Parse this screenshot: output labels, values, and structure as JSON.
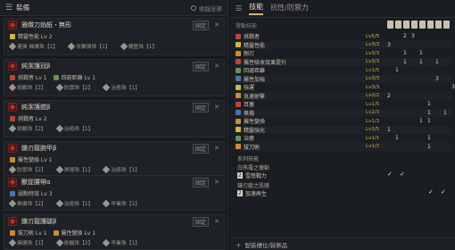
{
  "left_header": {
    "menu_icon": "hamburger-icon",
    "title": "裝備",
    "toggle_label": "收起全部"
  },
  "slots": [
    {
      "name": "雅緻刀焰紙・無形",
      "fix_label": "固定",
      "skills": [
        {
          "name": "精靈性能 Lv 2",
          "color": "y"
        }
      ],
      "decorations": [
        "連弾 擁護珠【1】",
        "攻擊弾珠【1】",
        "護壁珠【1】"
      ]
    },
    {
      "name": "純潔護冠β",
      "fix_label": "固定",
      "skills": [
        {
          "name": "挑戰者 Lv 1",
          "color": "r"
        },
        {
          "name": "回避距離 Lv 1",
          "color": "g"
        }
      ],
      "decorations": [
        "挑戰珠【2】",
        "防禦珠【2】",
        "治癒珠【1】"
      ]
    },
    {
      "name": "純潔護鎧β",
      "fix_label": "固定",
      "skills": [
        {
          "name": "挑戰者 Lv 2",
          "color": "r"
        }
      ],
      "decorations": [
        "挑戰珠【2】",
        "治癒珠【1】"
      ]
    },
    {
      "name": "鎌刃龍腕甲β",
      "fix_label": "固定",
      "skills": [
        {
          "name": "屬性變換 Lv 1",
          "color": "o"
        }
      ],
      "decorations": [
        "防禦珠【2】",
        "昂揚珠【1】",
        "治癒珠【1】"
      ]
    },
    {
      "name": "獸捉腰帶α",
      "fix_label": "固定",
      "skills": [
        {
          "name": "弱點特效 Lv 3",
          "color": "b"
        }
      ],
      "decorations": [
        "無傷珠【2】",
        "治癒珠【1】",
        "早業珠【1】"
      ]
    },
    {
      "name": "鎌刃龍護腿β",
      "fix_label": "固定",
      "skills": [
        {
          "name": "拔刀術 Lv 1",
          "color": "o"
        },
        {
          "name": "屬性變換 Lv 1",
          "color": "o"
        }
      ],
      "decorations": [
        "擁護珠【1】",
        "挑戰珠【2】",
        "早業珠【1】"
      ]
    }
  ],
  "right_header": {
    "icon": "sliders-icon",
    "tabs": [
      {
        "label": "技能",
        "active": true
      },
      {
        "label": "抗性/防禦力",
        "active": false
      }
    ]
  },
  "skills_section_label": "發動技能",
  "skills": [
    {
      "name": "挑戰者",
      "level": "Lv5/5",
      "max": true,
      "counts": [
        "",
        "",
        "2",
        "3",
        "",
        "",
        "",
        "",
        ""
      ]
    },
    {
      "name": "精靈性能",
      "level": "Lv3/3",
      "max": true,
      "counts": [
        "3",
        "",
        "",
        "",
        "",
        "",
        "",
        "",
        ""
      ]
    },
    {
      "name": "剛刃",
      "level": "Lv3/3",
      "max": true,
      "counts": [
        "",
        "",
        "1",
        "",
        "1",
        "",
        "",
        "",
        ""
      ]
    },
    {
      "name": "屬性吸收效果提升",
      "level": "Lv3/3",
      "max": true,
      "counts": [
        "",
        "",
        "1",
        "",
        "1",
        "",
        "1",
        "",
        ""
      ]
    },
    {
      "name": "回避距離",
      "level": "Lv1/5",
      "max": false,
      "counts": [
        "",
        "1",
        "",
        "",
        "",
        "",
        "",
        "",
        ""
      ]
    },
    {
      "name": "屬性加強",
      "level": "Lv3/3",
      "max": true,
      "counts": [
        "",
        "",
        "",
        "",
        "",
        "",
        "3",
        "",
        ""
      ]
    },
    {
      "name": "強運",
      "level": "Lv3/3",
      "max": true,
      "counts": [
        "",
        "",
        "",
        "",
        "",
        "",
        "",
        "",
        "3"
      ]
    },
    {
      "name": "急速射擊",
      "level": "Lv2/2",
      "max": true,
      "counts": [
        "2",
        "",
        "",
        "",
        "",
        "",
        "",
        "",
        ""
      ]
    },
    {
      "name": "耳塞",
      "level": "Lv1/5",
      "max": false,
      "counts": [
        "",
        "",
        "",
        "",
        "",
        "1",
        "",
        "",
        ""
      ]
    },
    {
      "name": "無傷",
      "level": "Lv2/3",
      "max": false,
      "counts": [
        "",
        "",
        "",
        "",
        "",
        "1",
        "",
        "1",
        ""
      ]
    },
    {
      "name": "屬性變換",
      "level": "Lv1/3",
      "max": false,
      "counts": [
        "",
        "",
        "",
        "",
        "1",
        "1",
        "",
        "",
        ""
      ]
    },
    {
      "name": "精靈強化",
      "level": "Lv1/5",
      "max": false,
      "counts": [
        "1",
        "",
        "",
        "",
        "",
        "",
        "",
        "",
        ""
      ]
    },
    {
      "name": "治癒",
      "level": "Lv1/1",
      "max": true,
      "counts": [
        "",
        "1",
        "",
        "",
        "",
        "1",
        "",
        "",
        ""
      ]
    },
    {
      "name": "拔刀術",
      "level": "Lv1/3",
      "max": false,
      "counts": [
        "",
        "",
        "",
        "",
        "",
        "1",
        "",
        "",
        ""
      ]
    }
  ],
  "set_section_label": "系列技能",
  "sets": [
    {
      "group": "白熊羅之獵動",
      "count": "2",
      "bonus": "雪怒戰力",
      "checks": [
        true,
        true,
        false,
        false
      ]
    },
    {
      "group": "鎌刃龍之肌膜",
      "count": "2",
      "bonus": "加速再生",
      "checks": [
        false,
        false,
        true,
        true
      ]
    }
  ],
  "bottom_label": "配裝槽位/裝飾品",
  "bottom_icon": "plus-icon"
}
